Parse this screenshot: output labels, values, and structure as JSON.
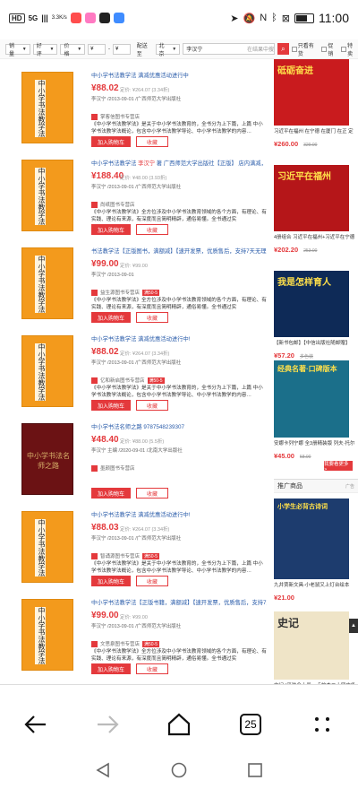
{
  "status_bar": {
    "left_badges": [
      "HD",
      "5G",
      "|||",
      "3.3K/s"
    ],
    "time": "11:00"
  },
  "filter_bar": {
    "sort_label": "销量",
    "sort_order_label": "好评",
    "price_label": "价格",
    "price_min_placeholder": "¥",
    "price_max_placeholder": "¥",
    "ship_to_label": "配送至",
    "ship_to_value": "北京",
    "search_value": "李汉宁",
    "search_scope": "在结果中搜",
    "checkbox_1": "只看有货",
    "checkbox_2": "促销",
    "checkbox_3": "特卖"
  },
  "products": [
    {
      "title_pre": "中小学书法教学法 满减优惠活动进行中",
      "title_hl": "",
      "title_post": "",
      "price": "¥88.02",
      "price_line": "定价: ¥264.07 (3.34折)",
      "author_line": "李汉宁 /2013-09-01 /广西师范大学出版社",
      "shop": "掌客信图书专营店",
      "shop_tag": "",
      "desc": "《中小学书法教学法》是关于中小学书法教育的，全书分为上下篇，上篇 中小学书法教学法概论，包含中小学书法教学导论、中小学书法教学的内容…",
      "cart_label": "加入购物车",
      "fav_label": "收藏",
      "cover": "orange"
    },
    {
      "title_pre": "中小学书法教学法 ",
      "title_hl": "李汉宁",
      "title_post": " 著 广西师范大学出版社【正版】 店内满减，可开",
      "price": "¥188.40",
      "price_line": "定价: ¥48.00 (3.93折)",
      "author_line": "李汉宁 /2013-09-01 /广西师范大学出版社",
      "shop": "尚纸图书专营店",
      "shop_tag": "",
      "desc": "《中小学书法教学法》全方位涉及中小学书法教育领域的各个方面，有理论、有实践、理论有来源，有深度而且简明精辟，通俗易懂。全书通过实",
      "cart_label": "加入购物车",
      "fav_label": "收藏",
      "cover": "orange"
    },
    {
      "title_pre": "书法教学法【正版图书，满额减】【速开发票，优质售后，支持7天无理由",
      "title_hl": "",
      "title_post": "",
      "price": "¥99.00",
      "price_line": "定价: ¥99.00",
      "author_line": "李汉宁 /2013-09-01",
      "shop": "益生源图书专营店",
      "shop_tag": "满50-5",
      "desc": "《中小学书法教学法》全方位涉及中小学书法教育领域的各个方面，有理论、有实践、理论有来源，有深度而且简明精辟，通俗易懂。全书通过实",
      "cart_label": "加入购物车",
      "fav_label": "收藏",
      "cover": "orange"
    },
    {
      "title_pre": "中小学书法教学法 满减优惠活动进行中!",
      "title_hl": "",
      "title_post": "",
      "price": "¥88.02",
      "price_line": "定价: ¥264.07 (3.34折)",
      "author_line": "李汉宁 /2013-09-01 /广西师范大学出版社",
      "shop": "亿和新启图书专营店",
      "shop_tag": "满50-5",
      "desc": "《中小学书法教学法》是关于中小学书法教育的，全书分为上下篇，上篇 中小学书法教学法概论，包含中小学书法教学导论、中小学书法教学的内容…",
      "cart_label": "加入购物车",
      "fav_label": "收藏",
      "cover": "orange"
    },
    {
      "title_pre": "中小学书法名师之路 9787548239307",
      "title_hl": "",
      "title_post": "",
      "price": "¥48.40",
      "price_line": "定价: ¥88.00 (5.5折)",
      "author_line": "李汉宁 主编 /2020-09-01 /北南大学出版社",
      "shop": "墨颜图书专营店",
      "shop_tag": "",
      "desc": "",
      "cart_label": "加入购物车",
      "fav_label": "收藏",
      "cover": "dark",
      "cover_title": "中小学书法名师之路"
    },
    {
      "title_pre": "中小学书法教学法 满减优惠活动进行中!",
      "title_hl": "",
      "title_post": "",
      "price": "¥88.03",
      "price_line": "定价: ¥264.07 (3.34折)",
      "author_line": "李汉宁 /2013-09-01 /广西师范大学出版社",
      "shop": "智诵源图书专营店",
      "shop_tag": "满50-5",
      "desc": "《中小学书法教学法》是关于中小学书法教育的，全书分为上下篇，上篇 中小学书法教学法概论，包含中小学书法教学导论、中小学书法教学的内容…",
      "cart_label": "加入购物车",
      "fav_label": "收藏",
      "cover": "orange"
    },
    {
      "title_pre": "中小学书法教学法【正版书籍，满额减】【速开发票，优质售后，支持7天",
      "title_hl": "",
      "title_post": "",
      "price": "¥99.00",
      "price_line": "定价: ¥99.00",
      "author_line": "李汉宁 /2013-09-01 /广西师范大学出版社",
      "shop": "文思泉图书专营店",
      "shop_tag": "满50-5",
      "desc": "《中小学书法教学法》全方位涉及中小学书法教育领域的各个方面，有理论、有实践、理论有来源，有深度而且简明精辟，通俗易懂。全书通过实",
      "cart_label": "加入购物车",
      "fav_label": "收藏",
      "cover": "orange"
    }
  ],
  "book_spine_text": "中小学书法教学法",
  "sidebar": {
    "ads": [
      {
        "img_text": "砥砺奋进",
        "title": "习近平在福州 在宁德 在厦门 在正 定 在...",
        "price": "¥260.00",
        "orig": "329.00",
        "color": "#c91b1e"
      },
      {
        "img_text": "习近平在福州",
        "title": "4册组合 习近平在福州+习近平在宁德+...",
        "price": "¥202.20",
        "orig": "253.00",
        "color": "#b51619"
      },
      {
        "img_text": "我是怎样育人",
        "title": "【新书包邮】【中信出版社随邮赠】",
        "price": "¥57.20",
        "orig": "多色装",
        "color": "#0e2a57"
      },
      {
        "img_text": "经典名著·口碑版本",
        "title": "安娜卡列宁娜 全3册精装版 列夫·托尔斯泰",
        "price": "¥45.00",
        "orig": "58.00",
        "color": "#1b6f8a"
      }
    ],
    "more_label": "我要看更多 >",
    "rec_heading": "推广商品",
    "rec_ad_label": "广告",
    "recs": [
      {
        "img_text": "小学生必背古诗词",
        "title": "九井贾新文具-小老鼠又上灯台绘本",
        "price": "¥21.00",
        "color": "#1d3c6e"
      },
      {
        "img_text": "史记",
        "title": "史记 (平装全十册，点校本二十四史修订本)",
        "price": "",
        "color": "#efe4c7"
      }
    ]
  },
  "browser_nav": {
    "back_label": "←",
    "forward_label": "→",
    "tab_count": "25"
  }
}
